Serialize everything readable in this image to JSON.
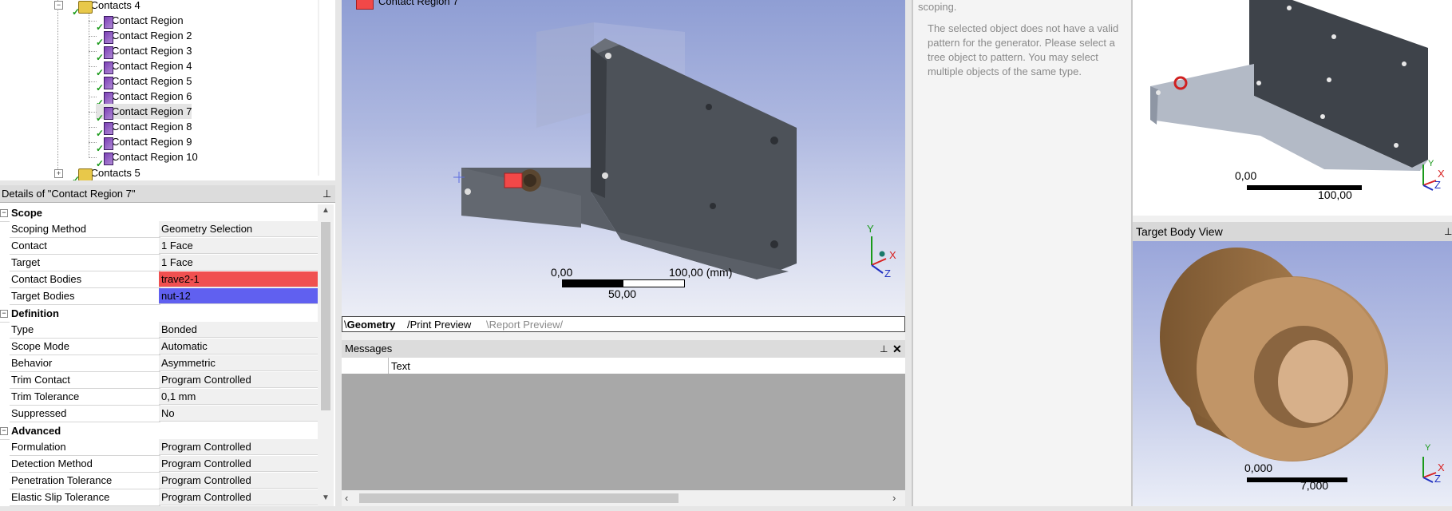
{
  "tree": {
    "contacts4_label": "Contacts 4",
    "contacts5_label": "Contacts 5",
    "regions": [
      "Contact Region",
      "Contact Region 2",
      "Contact Region 3",
      "Contact Region 4",
      "Contact Region 5",
      "Contact Region 6",
      "Contact Region 7",
      "Contact Region 8",
      "Contact Region 9",
      "Contact Region 10"
    ]
  },
  "details": {
    "title": "Details of \"Contact Region 7\"",
    "scope_label": "Scope",
    "scope_rows": [
      {
        "name": "Scoping Method",
        "value": "Geometry Selection"
      },
      {
        "name": "Contact",
        "value": "1 Face"
      },
      {
        "name": "Target",
        "value": "1 Face"
      },
      {
        "name": "Contact Bodies",
        "value": "trave2-1"
      },
      {
        "name": "Target Bodies",
        "value": "nut-12"
      }
    ],
    "definition_label": "Definition",
    "definition_rows": [
      {
        "name": "Type",
        "value": "Bonded"
      },
      {
        "name": "Scope Mode",
        "value": "Automatic"
      },
      {
        "name": "Behavior",
        "value": "Asymmetric"
      },
      {
        "name": "Trim Contact",
        "value": "Program Controlled"
      },
      {
        "name": "Trim Tolerance",
        "value": "0,1 mm"
      },
      {
        "name": "Suppressed",
        "value": "No"
      }
    ],
    "advanced_label": "Advanced",
    "advanced_rows": [
      {
        "name": "Formulation",
        "value": "Program Controlled"
      },
      {
        "name": "Detection Method",
        "value": "Program Controlled"
      },
      {
        "name": "Penetration Tolerance",
        "value": "Program Controlled"
      },
      {
        "name": "Elastic Slip Tolerance",
        "value": "Program Controlled"
      }
    ],
    "contact_color": "#f05050",
    "target_color": "#6060f0"
  },
  "viewport": {
    "legend_label": "Contact Region 7",
    "scale_left": "0,00",
    "scale_right": "100,00 (mm)",
    "scale_mid": "50,00",
    "axis_y": "Y",
    "axis_x": "X",
    "axis_z": "Z"
  },
  "tabs": [
    "Geometry",
    "Print Preview",
    "Report Preview"
  ],
  "messages": {
    "title": "Messages",
    "col_text": "Text"
  },
  "info": {
    "top_text": "scoping.",
    "text": "The selected object does not have a valid pattern for the generator. Please select a tree object to pattern. You may select multiple objects of the same type."
  },
  "preview_top": {
    "scale_left": "0,00",
    "scale_right": "100,00",
    "axis_y": "Y",
    "axis_x": "X",
    "axis_z": "Z"
  },
  "target_view": {
    "title": "Target Body View",
    "scale_left": "0,000",
    "scale_right": "7,000",
    "axis_y": "Y",
    "axis_x": "X",
    "axis_z": "Z"
  }
}
